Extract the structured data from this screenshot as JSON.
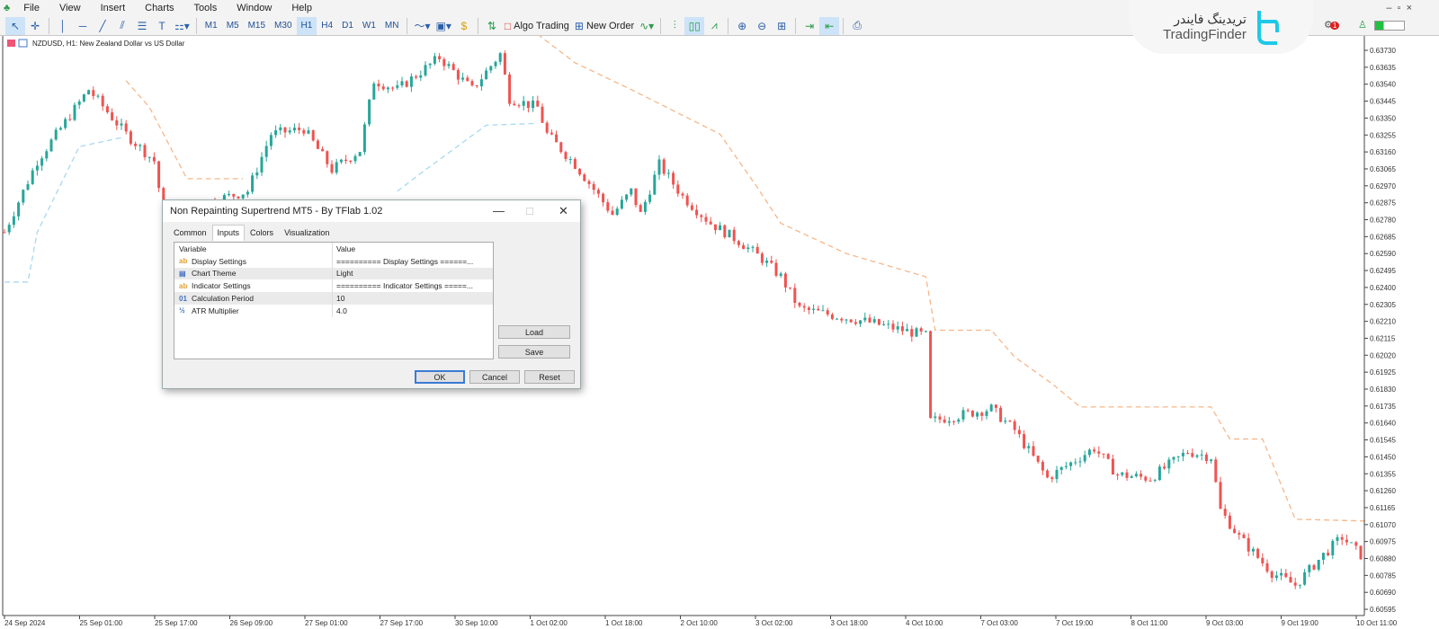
{
  "menu": [
    "File",
    "View",
    "Insert",
    "Charts",
    "Tools",
    "Window",
    "Help"
  ],
  "timeframes": [
    "M1",
    "M5",
    "M15",
    "M30",
    "H1",
    "H4",
    "D1",
    "W1",
    "MN"
  ],
  "active_timeframe": "H1",
  "toolbar": {
    "algo_trading": "Algo Trading",
    "new_order": "New Order"
  },
  "logo": {
    "persian": "تریدینگ فایندر",
    "latin": "TradingFinder"
  },
  "notification_count": "1",
  "chart": {
    "title": "NZDUSD, H1:  New Zealand Dollar vs US Dollar"
  },
  "colors": {
    "bull": "#26a69a",
    "bear": "#ef5350",
    "upper": "#f5b78a",
    "lower": "#a9d8ef"
  },
  "chart_data": {
    "type": "candlestick",
    "symbol": "NZDUSD",
    "timeframe": "H1",
    "ylim": [
      0.60595,
      0.6373
    ],
    "price_ticks": [
      "0.63730",
      "0.63635",
      "0.63540",
      "0.63445",
      "0.63350",
      "0.63255",
      "0.63160",
      "0.63065",
      "0.62970",
      "0.62875",
      "0.62780",
      "0.62685",
      "0.62590",
      "0.62495",
      "0.62400",
      "0.62305",
      "0.62210",
      "0.62115",
      "0.62020",
      "0.61925",
      "0.61830",
      "0.61735",
      "0.61640",
      "0.61545",
      "0.61450",
      "0.61355",
      "0.61260",
      "0.61165",
      "0.61070",
      "0.60975",
      "0.60880",
      "0.60785",
      "0.60690",
      "0.60595"
    ],
    "time_ticks": [
      "24 Sep 2024",
      "25 Sep 01:00",
      "25 Sep 17:00",
      "26 Sep 09:00",
      "27 Sep 01:00",
      "27 Sep 17:00",
      "30 Sep 10:00",
      "1 Oct 02:00",
      "1 Oct 18:00",
      "2 Oct 10:00",
      "3 Oct 02:00",
      "3 Oct 18:00",
      "4 Oct 10:00",
      "7 Oct 03:00",
      "7 Oct 19:00",
      "8 Oct 11:00",
      "9 Oct 03:00",
      "9 Oct 19:00",
      "10 Oct 11:00"
    ],
    "close_path": [
      [
        0,
        0.6271
      ],
      [
        7,
        0.6311
      ],
      [
        18,
        0.6351
      ],
      [
        26,
        0.6326
      ],
      [
        32,
        0.6311
      ],
      [
        34,
        0.6281
      ],
      [
        52,
        0.6294
      ],
      [
        57,
        0.6326
      ],
      [
        64,
        0.6329
      ],
      [
        70,
        0.6306
      ],
      [
        76,
        0.6317
      ],
      [
        79,
        0.6356
      ],
      [
        84,
        0.6351
      ],
      [
        93,
        0.6369
      ],
      [
        100,
        0.6351
      ],
      [
        106,
        0.6371
      ],
      [
        108,
        0.6346
      ],
      [
        114,
        0.6341
      ],
      [
        116,
        0.6326
      ],
      [
        122,
        0.6309
      ],
      [
        130,
        0.6281
      ],
      [
        134,
        0.6294
      ],
      [
        136,
        0.6281
      ],
      [
        140,
        0.6309
      ],
      [
        145,
        0.6291
      ],
      [
        151,
        0.6276
      ],
      [
        157,
        0.6266
      ],
      [
        162,
        0.6256
      ],
      [
        166,
        0.6246
      ],
      [
        170,
        0.6228
      ],
      [
        184,
        0.6221
      ],
      [
        197,
        0.6213
      ],
      [
        198,
        0.6165
      ],
      [
        211,
        0.6172
      ],
      [
        216,
        0.616
      ],
      [
        223,
        0.6133
      ],
      [
        233,
        0.615
      ],
      [
        238,
        0.6135
      ],
      [
        245,
        0.6133
      ],
      [
        253,
        0.6148
      ],
      [
        258,
        0.6145
      ],
      [
        260,
        0.6115
      ],
      [
        264,
        0.61
      ],
      [
        271,
        0.608
      ],
      [
        276,
        0.6073
      ],
      [
        282,
        0.609
      ],
      [
        286,
        0.61
      ],
      [
        290,
        0.609
      ]
    ],
    "supertrend_upper": [
      [
        [
          26,
          0.6356
        ],
        [
          31,
          0.6341
        ],
        [
          39,
          0.6301
        ],
        [
          51,
          0.6301
        ]
      ],
      [
        [
          114,
          0.6382
        ],
        [
          122,
          0.6366
        ],
        [
          134,
          0.6351
        ],
        [
          153,
          0.6326
        ],
        [
          161,
          0.6296
        ],
        [
          166,
          0.6276
        ],
        [
          180,
          0.6259
        ],
        [
          197,
          0.6246
        ],
        [
          199,
          0.6216
        ],
        [
          211,
          0.6216
        ],
        [
          216,
          0.6201
        ],
        [
          224,
          0.6186
        ],
        [
          230,
          0.6173
        ],
        [
          258,
          0.6173
        ],
        [
          262,
          0.6155
        ],
        [
          269,
          0.6155
        ],
        [
          276,
          0.611
        ],
        [
          291,
          0.6109
        ]
      ]
    ],
    "supertrend_lower": [
      [
        [
          0,
          0.6243
        ],
        [
          5,
          0.6243
        ],
        [
          7,
          0.6271
        ],
        [
          16,
          0.6319
        ],
        [
          25,
          0.6324
        ]
      ],
      [
        [
          84,
          0.6294
        ],
        [
          89,
          0.6304
        ],
        [
          103,
          0.6331
        ],
        [
          114,
          0.6332
        ]
      ]
    ]
  },
  "dialog": {
    "title": "Non Repainting Supertrend MT5 - By TFlab 1.02",
    "tabs": [
      "Common",
      "Inputs",
      "Colors",
      "Visualization"
    ],
    "active_tab": "Inputs",
    "columns": [
      "Variable",
      "Value"
    ],
    "rows": [
      {
        "icon": "ab",
        "variable": "Display Settings",
        "value": "========== Display Settings ======..."
      },
      {
        "icon": "▤",
        "variable": "Chart Theme",
        "value": "Light"
      },
      {
        "icon": "ab",
        "variable": "Indicator Settings",
        "value": "========== Indicator Settings =====..."
      },
      {
        "icon": "01",
        "variable": "Calculation Period",
        "value": "10"
      },
      {
        "icon": "½",
        "variable": "ATR Multiplier",
        "value": "4.0"
      }
    ],
    "load": "Load",
    "save": "Save",
    "ok": "OK",
    "cancel": "Cancel",
    "reset": "Reset"
  }
}
